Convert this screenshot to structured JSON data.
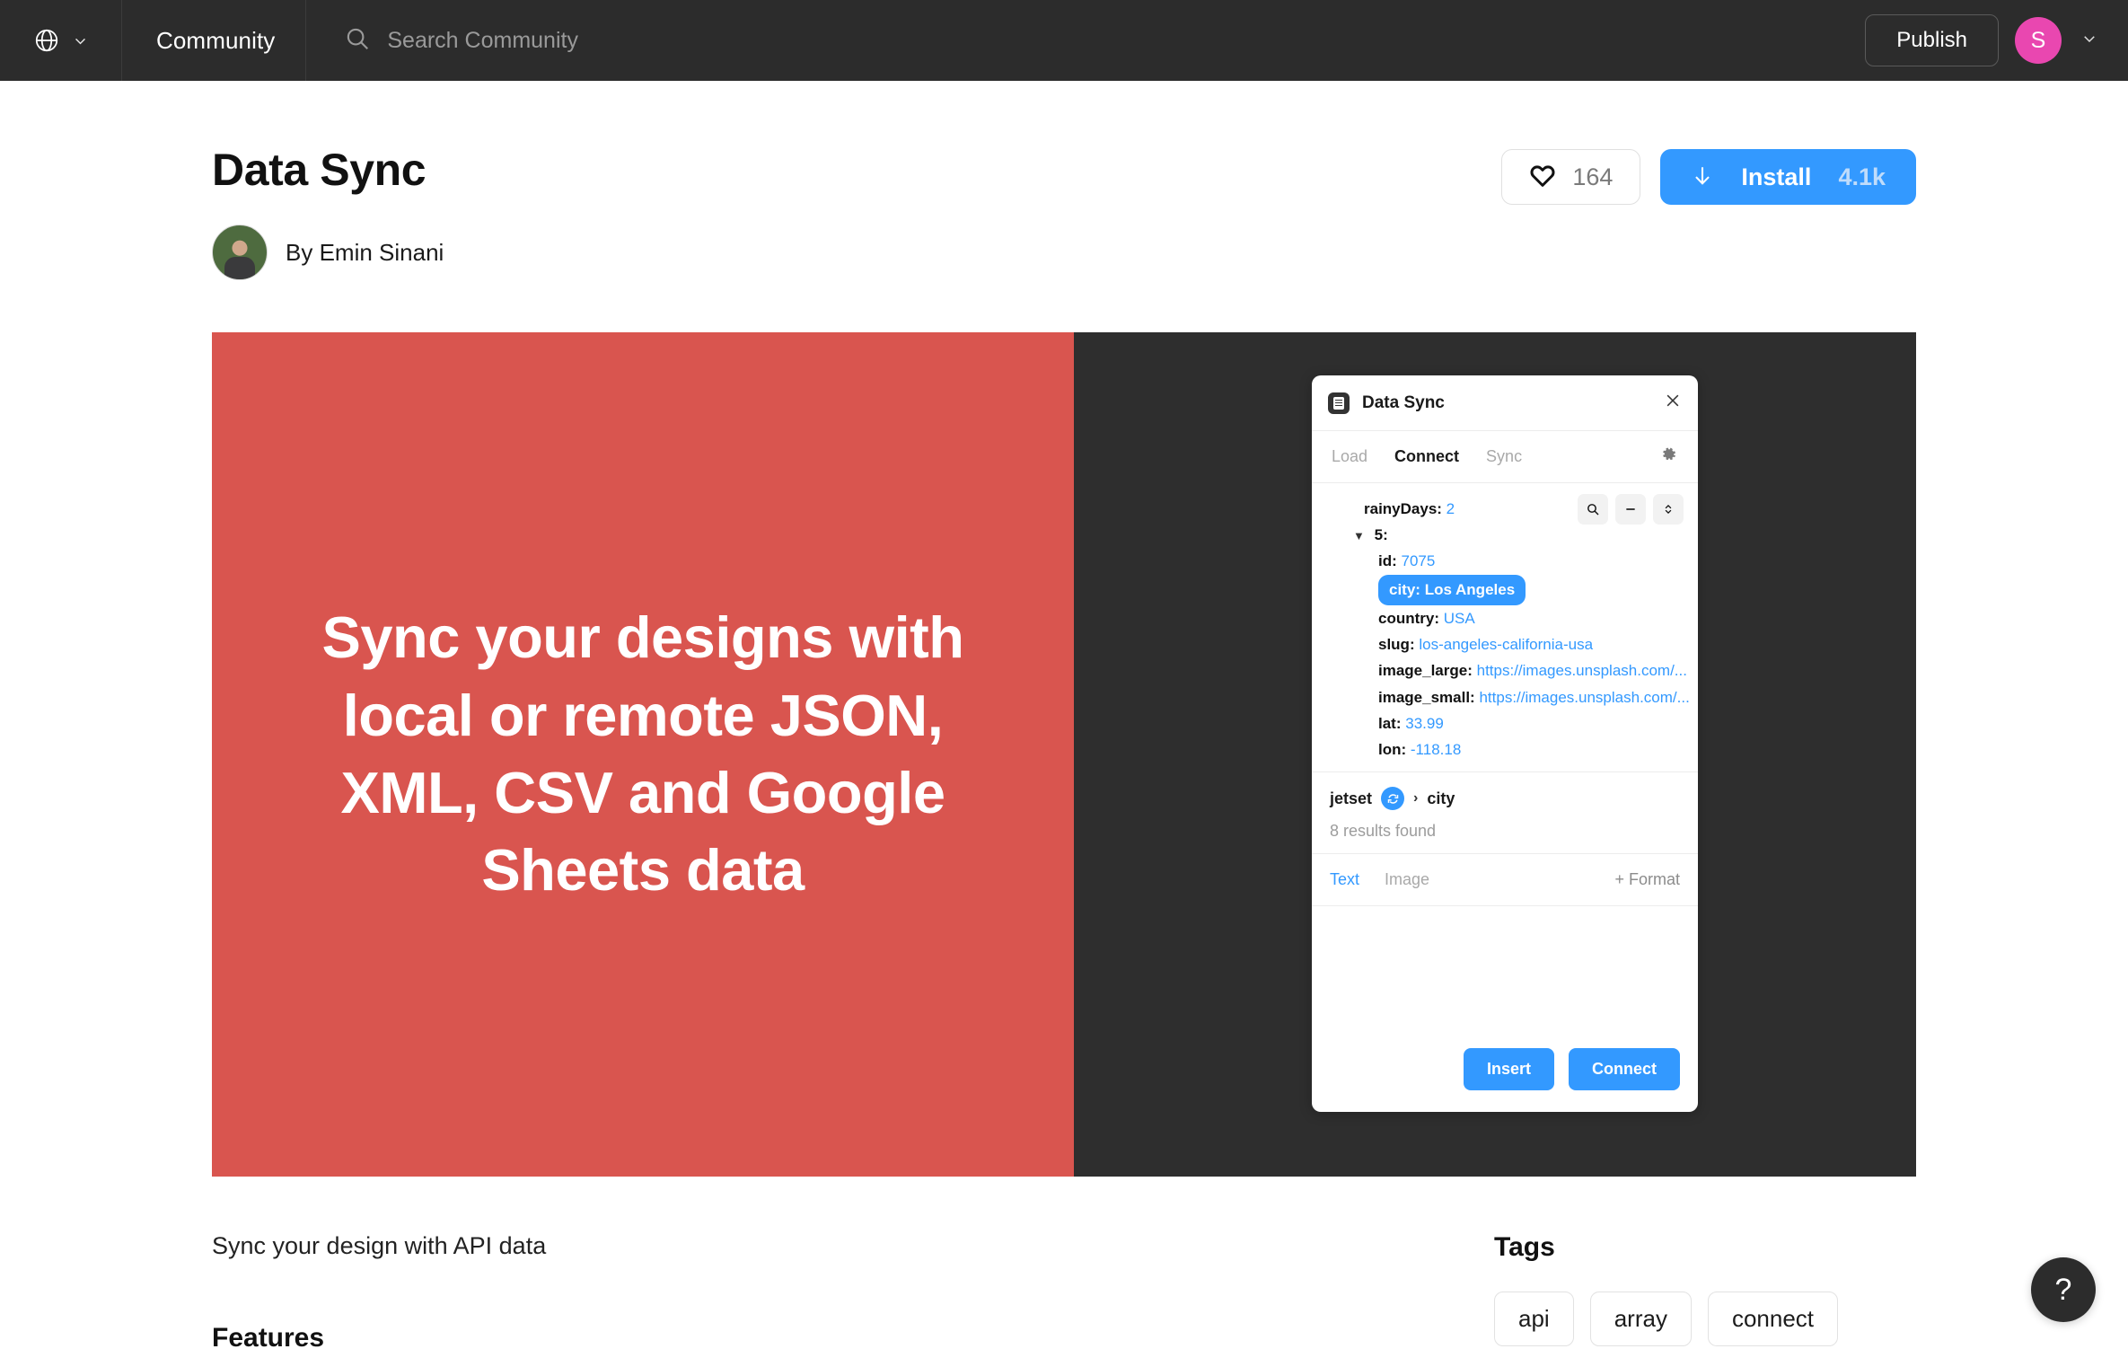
{
  "topbar": {
    "globe_icon": "globe-icon",
    "globe_chevron_icon": "chevron-down-icon",
    "community_label": "Community",
    "search_icon": "search-icon",
    "search_placeholder": "Search Community",
    "search_value": "",
    "publish_label": "Publish",
    "avatar_initial": "S",
    "avatar_chevron_icon": "chevron-down-icon",
    "avatar_color": "#e947b0",
    "background": "#2c2c2c"
  },
  "plugin": {
    "title": "Data Sync",
    "author_prefix": "By",
    "author_name": "Emin Sinani",
    "like_icon": "heart-icon",
    "like_count": "164",
    "install_icon": "download-arrow-icon",
    "install_label": "Install",
    "install_count": "4.1k",
    "install_color": "#3399ff"
  },
  "cover": {
    "left_bg": "#d9554f",
    "right_bg": "#2e2e2e",
    "hero_text": "Sync your designs with local or remote JSON, XML, CSV and Google Sheets data"
  },
  "panel": {
    "doc_icon": "document-icon",
    "title": "Data Sync",
    "close_icon": "close-icon",
    "tabs": [
      {
        "label": "Load",
        "active": false
      },
      {
        "label": "Connect",
        "active": true
      },
      {
        "label": "Sync",
        "active": false
      }
    ],
    "gear_icon": "gear-icon",
    "tools": [
      {
        "name": "search-icon"
      },
      {
        "name": "minus-icon"
      },
      {
        "name": "stepper-icon"
      }
    ],
    "tree": {
      "rainy_key": "rainyDays:",
      "rainy_value": "2",
      "node_index": "5:",
      "rows": [
        {
          "key": "id:",
          "value": "7075",
          "highlight": false
        },
        {
          "key": "city:",
          "value": "Los Angeles",
          "highlight": true
        },
        {
          "key": "country:",
          "value": "USA",
          "highlight": false
        },
        {
          "key": "slug:",
          "value": "los-angeles-california-usa",
          "highlight": false
        },
        {
          "key": "image_large:",
          "value": "https://images.unsplash.com/...",
          "highlight": false
        },
        {
          "key": "image_small:",
          "value": "https://images.unsplash.com/...",
          "highlight": false
        },
        {
          "key": "lat:",
          "value": "33.99",
          "highlight": false
        },
        {
          "key": "lon:",
          "value": "-118.18",
          "highlight": false
        }
      ]
    },
    "breadcrumb": {
      "root": "jetset",
      "sync_icon": "sync-icon",
      "separator": "›",
      "leaf": "city"
    },
    "results_text": "8 results found",
    "format_tabs": [
      {
        "label": "Text",
        "active": true
      },
      {
        "label": "Image",
        "active": false
      }
    ],
    "add_format_label": "+ Format",
    "buttons": {
      "insert": "Insert",
      "connect": "Connect"
    }
  },
  "below": {
    "description": "Sync your design with API data",
    "features_heading": "Features",
    "tags_heading": "Tags",
    "tags": [
      "api",
      "array",
      "connect"
    ]
  },
  "help": {
    "label": "?"
  }
}
